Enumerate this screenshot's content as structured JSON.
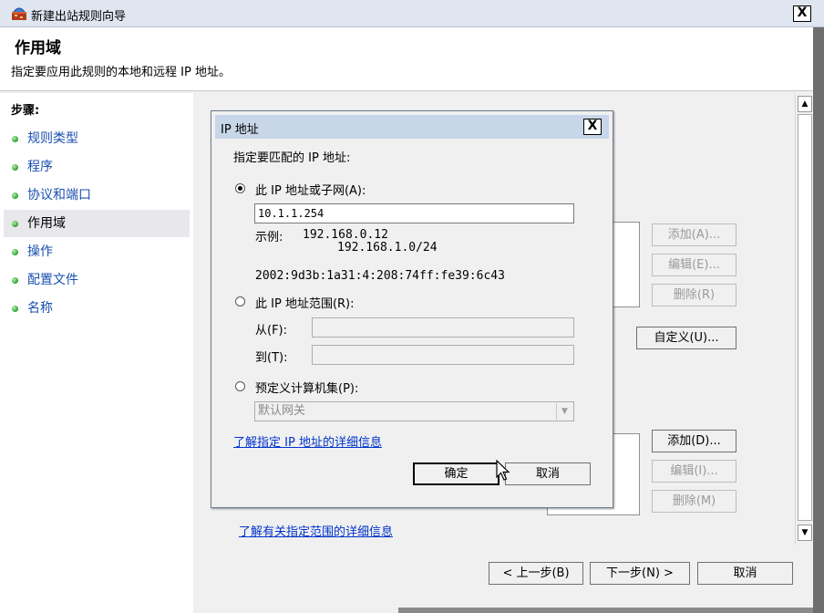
{
  "window": {
    "title": "新建出站规则向导",
    "header_title": "作用域",
    "header_subtitle": "指定要应用此规则的本地和远程 IP 地址。",
    "close_label": "X"
  },
  "steps": {
    "title": "步骤:",
    "items": [
      {
        "label": "规则类型",
        "active": false
      },
      {
        "label": "程序",
        "active": false
      },
      {
        "label": "协议和端口",
        "active": false
      },
      {
        "label": "作用域",
        "active": true
      },
      {
        "label": "操作",
        "active": false
      },
      {
        "label": "配置文件",
        "active": false
      },
      {
        "label": "名称",
        "active": false
      }
    ]
  },
  "local_buttons": {
    "add": "添加(A)...",
    "edit": "编辑(E)...",
    "remove": "删除(R)"
  },
  "customize_button": "自定义(U)...",
  "remote_buttons": {
    "add": "添加(D)...",
    "edit": "编辑(I)...",
    "remove": "删除(M)"
  },
  "scope_link": "了解有关指定范围的详细信息",
  "nav": {
    "back": "< 上一步(B)",
    "next": "下一步(N) >",
    "cancel": "取消"
  },
  "dialog": {
    "title": "IP 地址",
    "close_label": "X",
    "instruction": "指定要匹配的 IP 地址:",
    "option_subnet": "此 IP 地址或子网(A):",
    "ip_value": "10.1.1.254",
    "example_label": "示例:",
    "example_1": "192.168.0.12",
    "example_2": "192.168.1.0/24",
    "example_3": "2002:9d3b:1a31:4:208:74ff:fe39:6c43",
    "option_range": "此 IP 地址范围(R):",
    "from_label": "从(F):",
    "to_label": "到(T):",
    "option_predefined": "预定义计算机集(P):",
    "predefined_value": "默认网关",
    "learn_link": "了解指定 IP 地址的详细信息",
    "ok": "确定",
    "cancel": "取消",
    "selected_option": "subnet"
  },
  "colors": {
    "link": "#0033cc",
    "step_dot": "#27a030",
    "titlebar": "#dfe6f0",
    "dialog_titlebar": "#c7d6e8"
  }
}
